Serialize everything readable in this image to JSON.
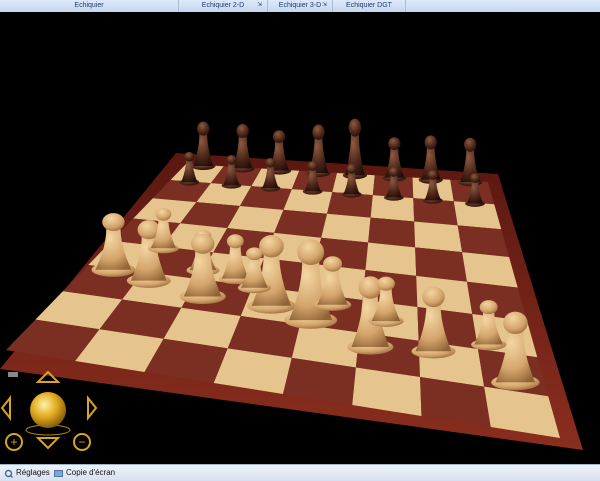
{
  "tabs": [
    {
      "label": "Echiquier"
    },
    {
      "label": "Echiquier 2-D"
    },
    {
      "label": "Echiquier 3-D"
    },
    {
      "label": "Echiquier DGT"
    }
  ],
  "bottom_bar": {
    "settings_label": "Réglages",
    "screenshot_label": "Copie d'écran"
  },
  "colors": {
    "light_square": "#e6c48d",
    "dark_square": "#7a2f22",
    "board_frame": "#6e1e14",
    "light_piece": "#d8b07a",
    "dark_piece": "#4a2418",
    "nav_gold": "#d9a520"
  },
  "icons": [
    "pin-icon",
    "settings-icon",
    "screenshot-icon",
    "zoom-in-icon",
    "zoom-out-icon",
    "arrow-up-icon",
    "arrow-down-icon",
    "arrow-left-icon",
    "arrow-right-icon",
    "rotate-sphere-icon"
  ]
}
